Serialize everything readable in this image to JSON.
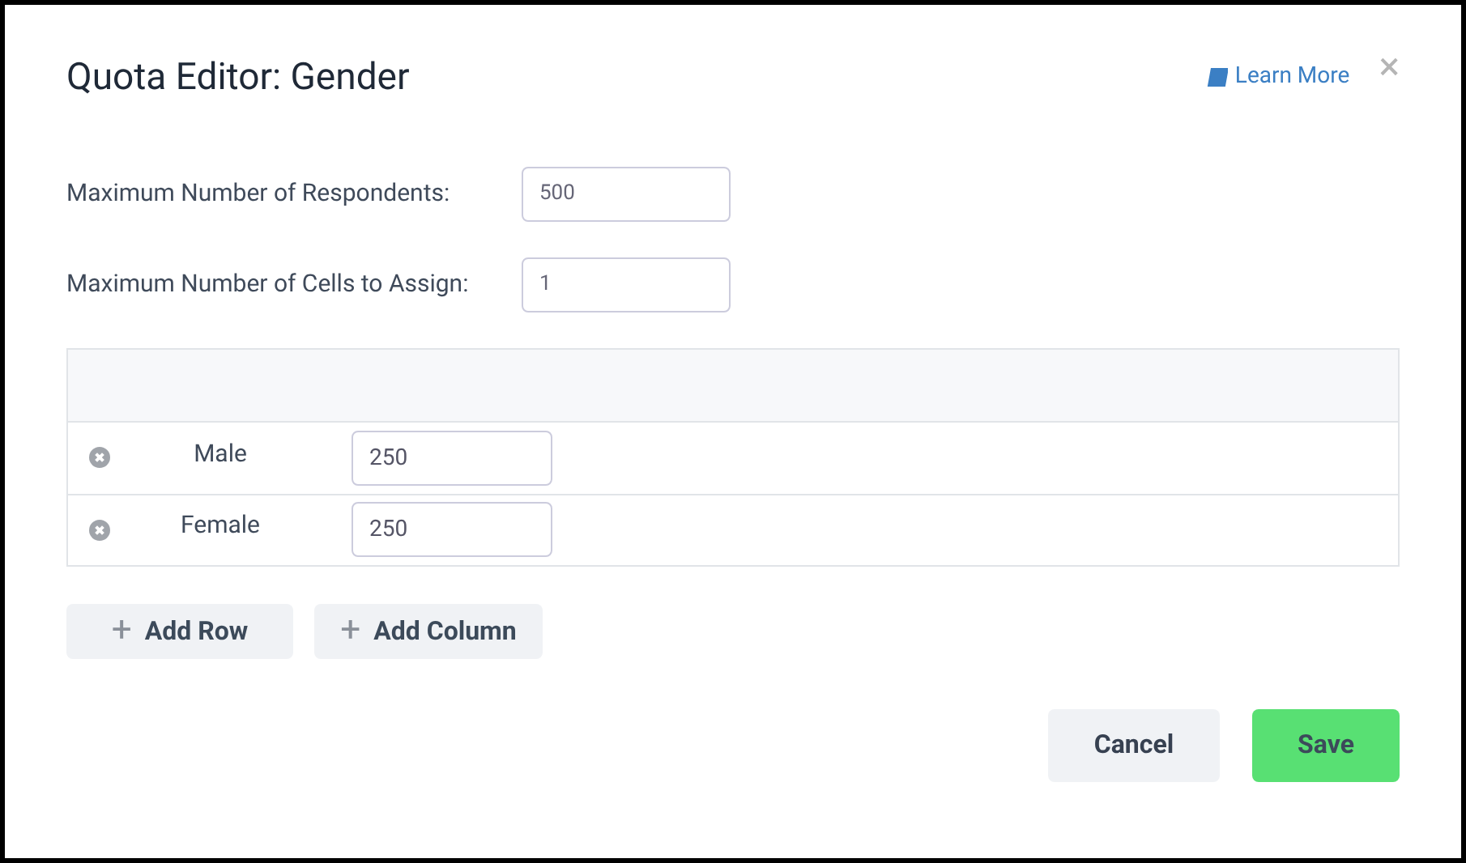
{
  "dialog": {
    "title": "Quota Editor: Gender",
    "learn_more": "Learn More",
    "close": "×"
  },
  "fields": [
    {
      "label": "Maximum Number of Respondents:",
      "value": "500"
    },
    {
      "label": "Maximum Number of Cells to Assign:",
      "value": "1"
    }
  ],
  "table": {
    "rows": [
      {
        "label": "Male",
        "value": "250"
      },
      {
        "label": "Female",
        "value": "250"
      }
    ]
  },
  "table_buttons": [
    {
      "label": "Add Row",
      "icon": "+"
    },
    {
      "label": "Add Column",
      "icon": "+"
    }
  ],
  "footer_buttons": [
    {
      "label": "Cancel",
      "kind": "secondary"
    },
    {
      "label": "Save",
      "kind": "primary"
    }
  ]
}
